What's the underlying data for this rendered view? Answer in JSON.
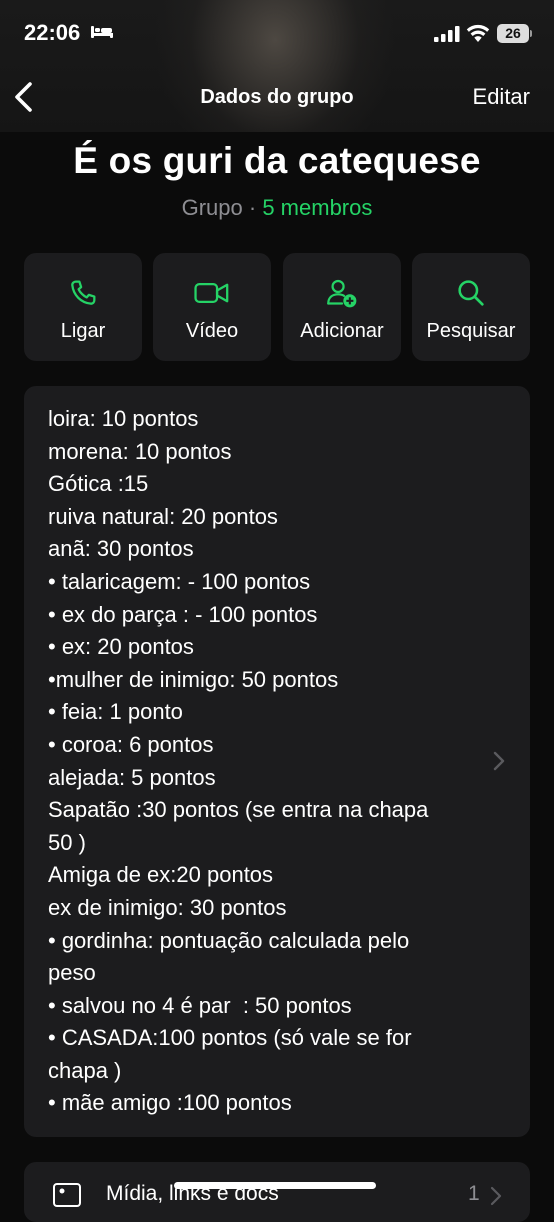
{
  "status": {
    "time": "22:06",
    "battery": "26"
  },
  "nav": {
    "title": "Dados do grupo",
    "edit": "Editar"
  },
  "group": {
    "name": "É os guri da catequese",
    "type": "Grupo",
    "separator": " · ",
    "members": "5 membros"
  },
  "actions": [
    {
      "label": "Ligar",
      "icon": "phone-icon"
    },
    {
      "label": "Vídeo",
      "icon": "video-icon"
    },
    {
      "label": "Adicionar",
      "icon": "add-person-icon"
    },
    {
      "label": "Pesquisar",
      "icon": "search-icon"
    }
  ],
  "description": "loira: 10 pontos\nmorena: 10 pontos\nGótica :15\nruiva natural: 20 pontos\nanã: 30 pontos\n• talaricagem: - 100 pontos\n• ex do parça : - 100 pontos\n• ex: 20 pontos\n•mulher de inimigo: 50 pontos\n• feia: 1 ponto\n• coroa: 6 pontos\nalejada: 5 pontos\nSapatão :30 pontos (se entra na chapa 50 )\nAmiga de ex:20 pontos\nex de inimigo: 30 pontos\n• gordinha: pontuação calculada pelo peso\n• salvou no 4 é par  : 50 pontos\n• CASADA:100 pontos (só vale se for chapa )\n• mãe amigo :100 pontos",
  "media": {
    "label": "Mídia, links e docs",
    "count": "1"
  },
  "colors": {
    "accent": "#25d366",
    "card": "#1c1c1e",
    "background": "#0b0b0b",
    "muted": "#8e8e93"
  }
}
